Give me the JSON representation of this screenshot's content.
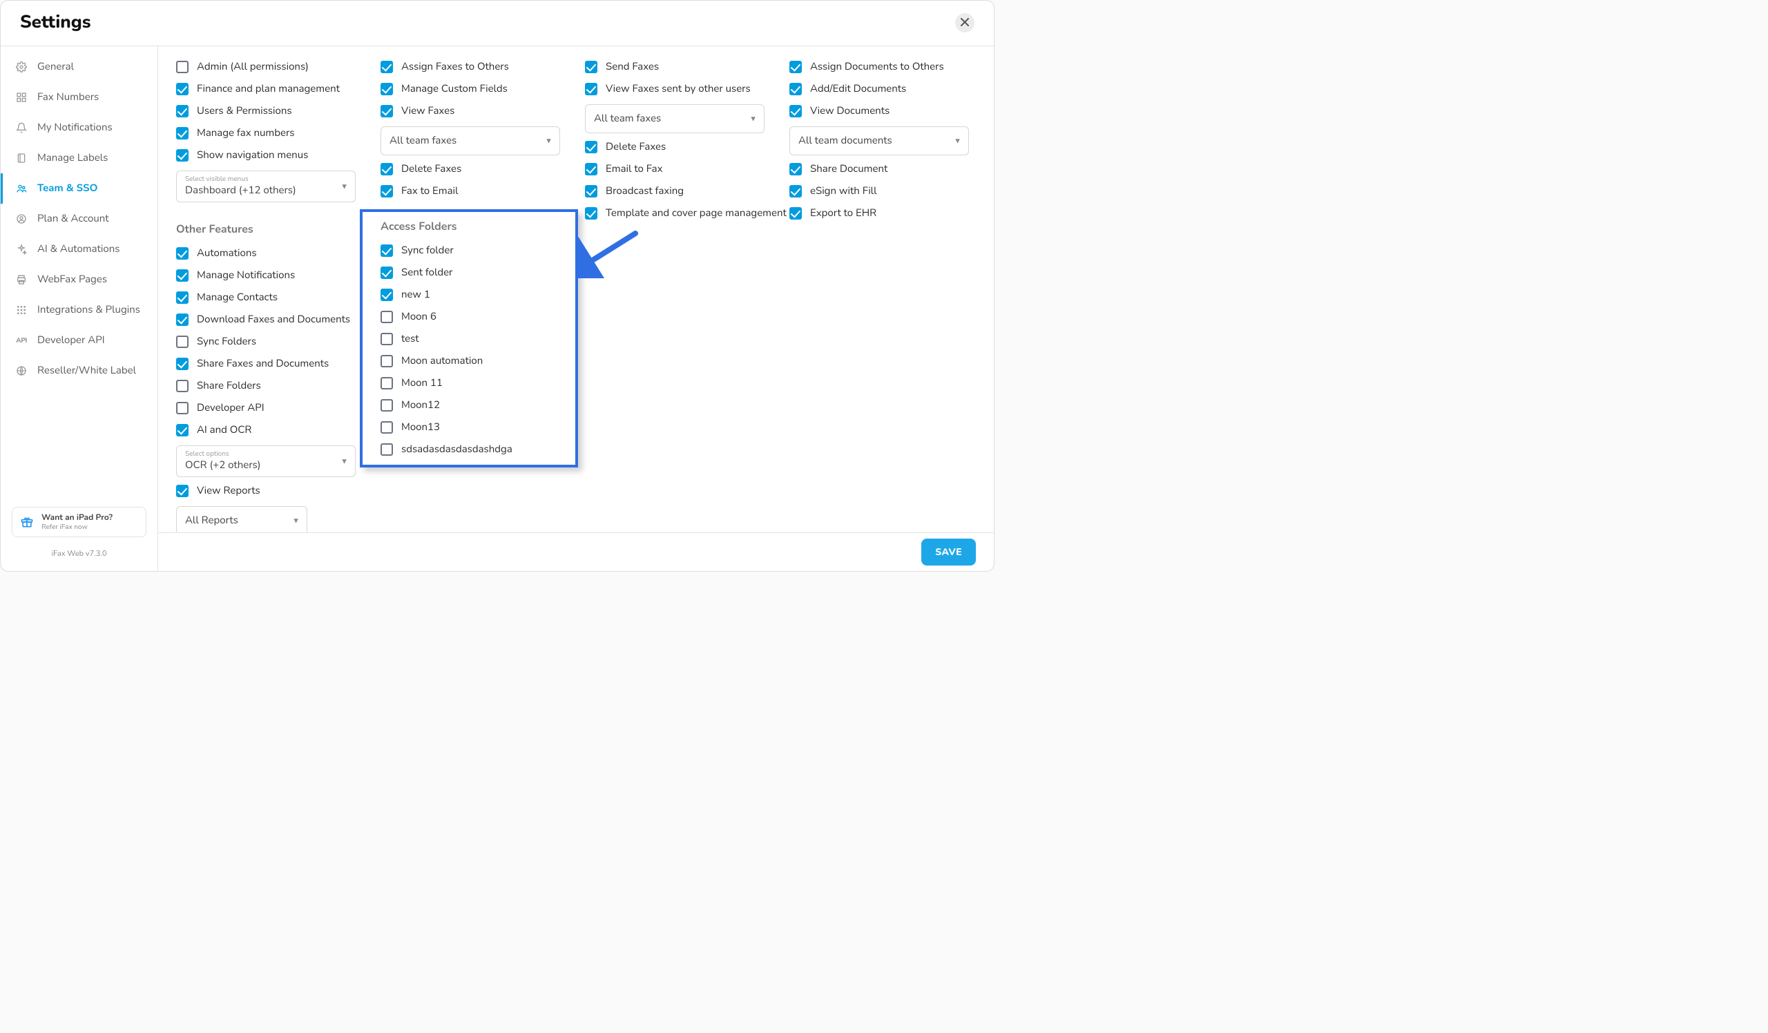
{
  "title": "Settings",
  "sidebar": {
    "items": [
      {
        "icon": "gear-icon",
        "label": "General"
      },
      {
        "icon": "hash-icon",
        "label": "Fax Numbers"
      },
      {
        "icon": "bell-icon",
        "label": "My Notifications"
      },
      {
        "icon": "tag-icon",
        "label": "Manage Labels"
      },
      {
        "icon": "users-icon",
        "label": "Team & SSO"
      },
      {
        "icon": "user-circle-icon",
        "label": "Plan & Account"
      },
      {
        "icon": "sparkle-icon",
        "label": "AI & Automations"
      },
      {
        "icon": "printer-icon",
        "label": "WebFax Pages"
      },
      {
        "icon": "grid-icon",
        "label": "Integrations & Plugins"
      },
      {
        "icon": "api-icon",
        "label": "Developer API"
      },
      {
        "icon": "globe-icon",
        "label": "Reseller/White Label"
      }
    ],
    "active_index": 4,
    "promo": {
      "line1": "Want an iPad Pro?",
      "line2": "Refer iFax now"
    },
    "version": "iFax Web v7.3.0"
  },
  "columns": [
    {
      "items": [
        {
          "type": "check",
          "label": "Admin (All permissions)",
          "checked": false
        },
        {
          "type": "check",
          "label": "Finance and plan management",
          "checked": true
        },
        {
          "type": "check",
          "label": "Users & Permissions",
          "checked": true
        },
        {
          "type": "check",
          "label": "Manage fax numbers",
          "checked": true
        },
        {
          "type": "check",
          "label": "Show navigation menus",
          "checked": true
        },
        {
          "type": "select",
          "hint": "Select visible menus",
          "value": "Dashboard (+12 others)"
        }
      ],
      "section": {
        "title": "Other Features",
        "items": [
          {
            "type": "check",
            "label": "Automations",
            "checked": true
          },
          {
            "type": "check",
            "label": "Manage Notifications",
            "checked": true
          },
          {
            "type": "check",
            "label": "Manage Contacts",
            "checked": true
          },
          {
            "type": "check",
            "label": "Download Faxes and Documents",
            "checked": true
          },
          {
            "type": "check",
            "label": "Sync Folders",
            "checked": false
          },
          {
            "type": "check",
            "label": "Share Faxes and Documents",
            "checked": true
          },
          {
            "type": "check",
            "label": "Share Folders",
            "checked": false
          },
          {
            "type": "check",
            "label": "Developer API",
            "checked": false
          },
          {
            "type": "check",
            "label": "AI and OCR",
            "checked": true
          },
          {
            "type": "select",
            "hint": "Select options",
            "value": "OCR (+2 others)"
          },
          {
            "type": "check",
            "label": "View Reports",
            "checked": true
          },
          {
            "type": "select",
            "value": "All Reports",
            "small": true
          }
        ]
      }
    },
    {
      "items": [
        {
          "type": "check",
          "label": "Assign Faxes to Others",
          "checked": true
        },
        {
          "type": "check",
          "label": "Manage Custom Fields",
          "checked": true
        },
        {
          "type": "check",
          "label": "View Faxes",
          "checked": true
        },
        {
          "type": "select",
          "value": "All team faxes"
        },
        {
          "type": "check",
          "label": "Delete Faxes",
          "checked": true
        },
        {
          "type": "check",
          "label": "Fax to Email",
          "checked": true
        }
      ],
      "section": {
        "title": "Access Folders",
        "items": [
          {
            "type": "check",
            "label": "Sync folder",
            "checked": true
          },
          {
            "type": "check",
            "label": "Sent folder",
            "checked": true
          },
          {
            "type": "check",
            "label": "new 1",
            "checked": true
          },
          {
            "type": "check",
            "label": "Moon 6",
            "checked": false
          },
          {
            "type": "check",
            "label": "test",
            "checked": false
          },
          {
            "type": "check",
            "label": "Moon automation",
            "checked": false
          },
          {
            "type": "check",
            "label": "Moon 11",
            "checked": false
          },
          {
            "type": "check",
            "label": "Moon12",
            "checked": false
          },
          {
            "type": "check",
            "label": "Moon13",
            "checked": false
          },
          {
            "type": "check",
            "label": "sdsadasdasdasdashdga",
            "checked": false
          }
        ]
      }
    },
    {
      "items": [
        {
          "type": "check",
          "label": "Send Faxes",
          "checked": true
        },
        {
          "type": "check",
          "label": "View Faxes sent by other users",
          "checked": true
        },
        {
          "type": "select",
          "value": "All team faxes"
        },
        {
          "type": "check",
          "label": "Delete Faxes",
          "checked": true
        },
        {
          "type": "check",
          "label": "Email to Fax",
          "checked": true
        },
        {
          "type": "check",
          "label": "Broadcast faxing",
          "checked": true
        },
        {
          "type": "check",
          "label": "Template and cover page management",
          "checked": true
        }
      ]
    },
    {
      "items": [
        {
          "type": "check",
          "label": "Assign Documents to Others",
          "checked": true
        },
        {
          "type": "check",
          "label": "Add/Edit Documents",
          "checked": true
        },
        {
          "type": "check",
          "label": "View Documents",
          "checked": true
        },
        {
          "type": "select",
          "value": "All team documents"
        },
        {
          "type": "check",
          "label": "Share Document",
          "checked": true
        },
        {
          "type": "check",
          "label": "eSign with Fill",
          "checked": true
        },
        {
          "type": "check",
          "label": "Export to EHR",
          "checked": true
        }
      ]
    }
  ],
  "save_label": "SAVE",
  "highlight_box": {
    "col": 1,
    "section": true
  },
  "arrow_target": "access-folders"
}
